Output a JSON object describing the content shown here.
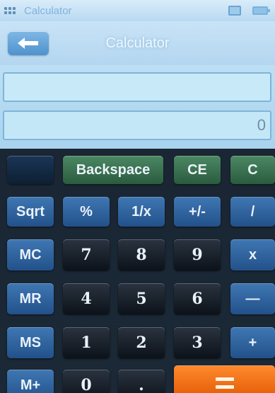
{
  "status_bar": {
    "app_name": "Calculator",
    "app_icon": "grid-icon",
    "indicators": [
      "message-icon",
      "battery-icon"
    ]
  },
  "header": {
    "title": "Calculator",
    "back_icon": "arrow-left-icon"
  },
  "display": {
    "memory_value": "",
    "result_value": "0"
  },
  "keypad": {
    "row1": [
      "Backspace",
      "CE",
      "C"
    ],
    "row2": [
      "Sqrt",
      "%",
      "1/x",
      "+/-",
      "/"
    ],
    "row3": [
      "MC",
      "7",
      "8",
      "9",
      "x"
    ],
    "row4": [
      "MR",
      "4",
      "5",
      "6",
      "—"
    ],
    "row5": [
      "MS",
      "1",
      "2",
      "3",
      "+"
    ],
    "row6": [
      "M+",
      "0",
      "."
    ],
    "equals_icon": "equals-icon"
  },
  "colors": {
    "blue_key": "#3f77b3",
    "dark_key": "#0c1219",
    "green_key": "#4c8864",
    "orange_key": "#ff8a2e",
    "display_bg": "#c4e7f7"
  }
}
